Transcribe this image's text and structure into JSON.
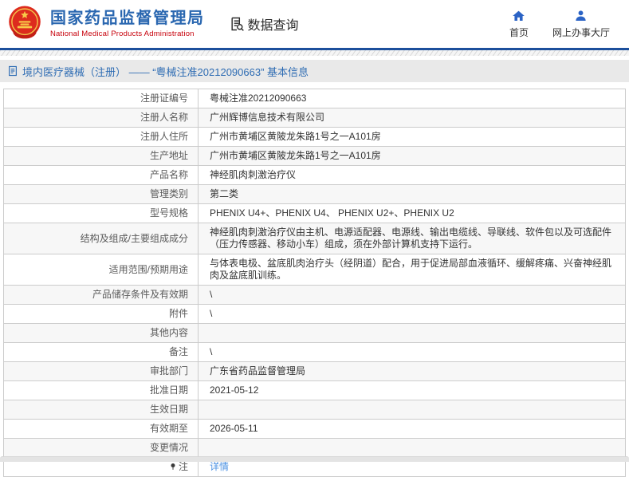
{
  "header": {
    "agency_name_cn": "国家药品监督管理局",
    "agency_name_en": "National Medical Products Administration",
    "data_query_label": "数据查询",
    "nav": [
      {
        "label": "首页",
        "icon": "home-icon"
      },
      {
        "label": "网上办事大厅",
        "icon": "user-icon"
      }
    ]
  },
  "breadcrumb": {
    "icon": "document-icon",
    "text": "境内医疗器械（注册） —— “粤械注准20212090663” 基本信息"
  },
  "table": {
    "rows": [
      {
        "label": "注册证编号",
        "value": "粤械注准20212090663"
      },
      {
        "label": "注册人名称",
        "value": "广州辉博信息技术有限公司"
      },
      {
        "label": "注册人住所",
        "value": "广州市黄埔区黄陂龙朱路1号之一A101房"
      },
      {
        "label": "生产地址",
        "value": "广州市黄埔区黄陂龙朱路1号之一A101房"
      },
      {
        "label": "产品名称",
        "value": "神经肌肉刺激治疗仪"
      },
      {
        "label": "管理类别",
        "value": "第二类"
      },
      {
        "label": "型号规格",
        "value": "PHENIX U4+、PHENIX U4、 PHENIX U2+、PHENIX U2"
      },
      {
        "label": "结构及组成/主要组成成分",
        "value": "神经肌肉刺激治疗仪由主机、电源适配器、电源线、输出电缆线、导联线、软件包以及可选配件（压力传感器、移动小车）组成，须在外部计算机支持下运行。"
      },
      {
        "label": "适用范围/预期用途",
        "value": "与体表电极、盆底肌肉治疗头（经阴道）配合，用于促进局部血液循环、缓解疼痛、兴奋神经肌肉及盆底肌训练。"
      },
      {
        "label": "产品储存条件及有效期",
        "value": "\\"
      },
      {
        "label": "附件",
        "value": "\\"
      },
      {
        "label": "其他内容",
        "value": ""
      },
      {
        "label": "备注",
        "value": "\\"
      },
      {
        "label": "审批部门",
        "value": "广东省药品监督管理局"
      },
      {
        "label": "批准日期",
        "value": "2021-05-12"
      },
      {
        "label": "生效日期",
        "value": ""
      },
      {
        "label": "有效期至",
        "value": "2026-05-11"
      },
      {
        "label": "变更情况",
        "value": ""
      },
      {
        "label": "注",
        "value": "详情",
        "value_is_link": true,
        "label_icon": "pin-icon"
      }
    ]
  },
  "colors": {
    "title_blue": "#2a67b0",
    "subtitle_red": "#c7000b",
    "divider_blue": "#1c4f9c",
    "breadcrumb_blue": "#2e6cb3",
    "link_blue": "#4a90e2",
    "emblem_red": "#dd2b1e",
    "icon_blue": "#2b63c5"
  }
}
